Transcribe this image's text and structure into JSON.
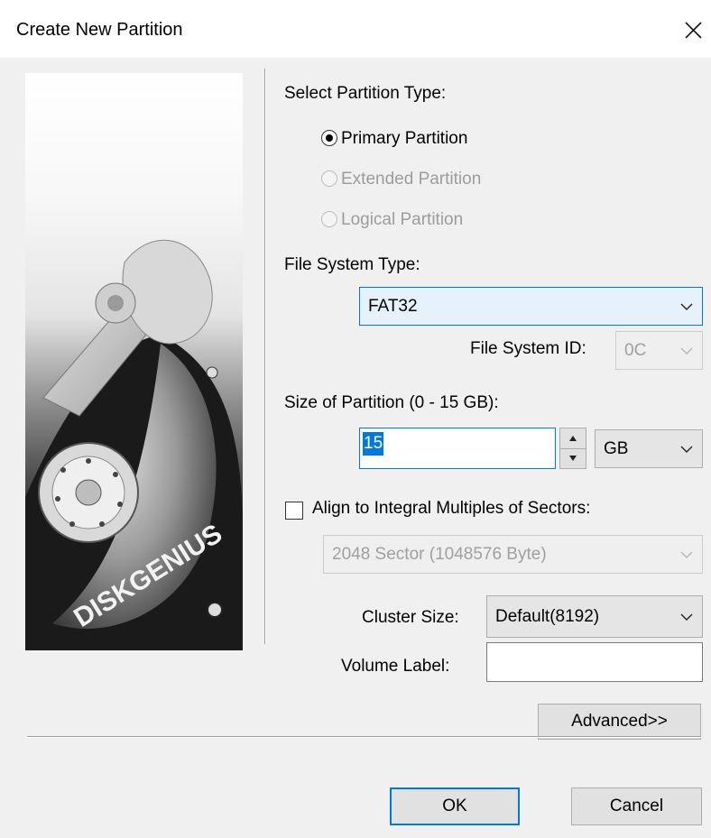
{
  "window": {
    "title": "Create New Partition"
  },
  "branding": {
    "logo_text": "DISKGENIUS"
  },
  "partition_type": {
    "heading": "Select Partition Type:",
    "options": [
      {
        "label": "Primary Partition",
        "checked": true,
        "enabled": true
      },
      {
        "label": "Extended Partition",
        "checked": false,
        "enabled": false
      },
      {
        "label": "Logical Partition",
        "checked": false,
        "enabled": false
      }
    ]
  },
  "file_system": {
    "heading": "File System Type:",
    "selected": "FAT32",
    "id_label": "File System ID:",
    "id_value": "0C"
  },
  "size": {
    "heading": "Size of Partition (0 - 15 GB):",
    "value": "15",
    "unit": "GB"
  },
  "align": {
    "label": "Align to Integral Multiples of Sectors:",
    "checked": false,
    "selected": "2048 Sector (1048576 Byte)"
  },
  "cluster": {
    "label": "Cluster Size:",
    "selected": "Default(8192)"
  },
  "volume": {
    "label": "Volume Label:",
    "value": ""
  },
  "buttons": {
    "advanced": "Advanced>>",
    "ok": "OK",
    "cancel": "Cancel"
  },
  "colors": {
    "accent": "#0078d7",
    "dialog_bg": "#f0f0f0",
    "disabled_text": "#9c9c9c"
  },
  "icons": {
    "close": "close-icon",
    "dropdown": "chevron-down-icon",
    "spin_up": "spin-up-icon",
    "spin_down": "spin-down-icon"
  }
}
